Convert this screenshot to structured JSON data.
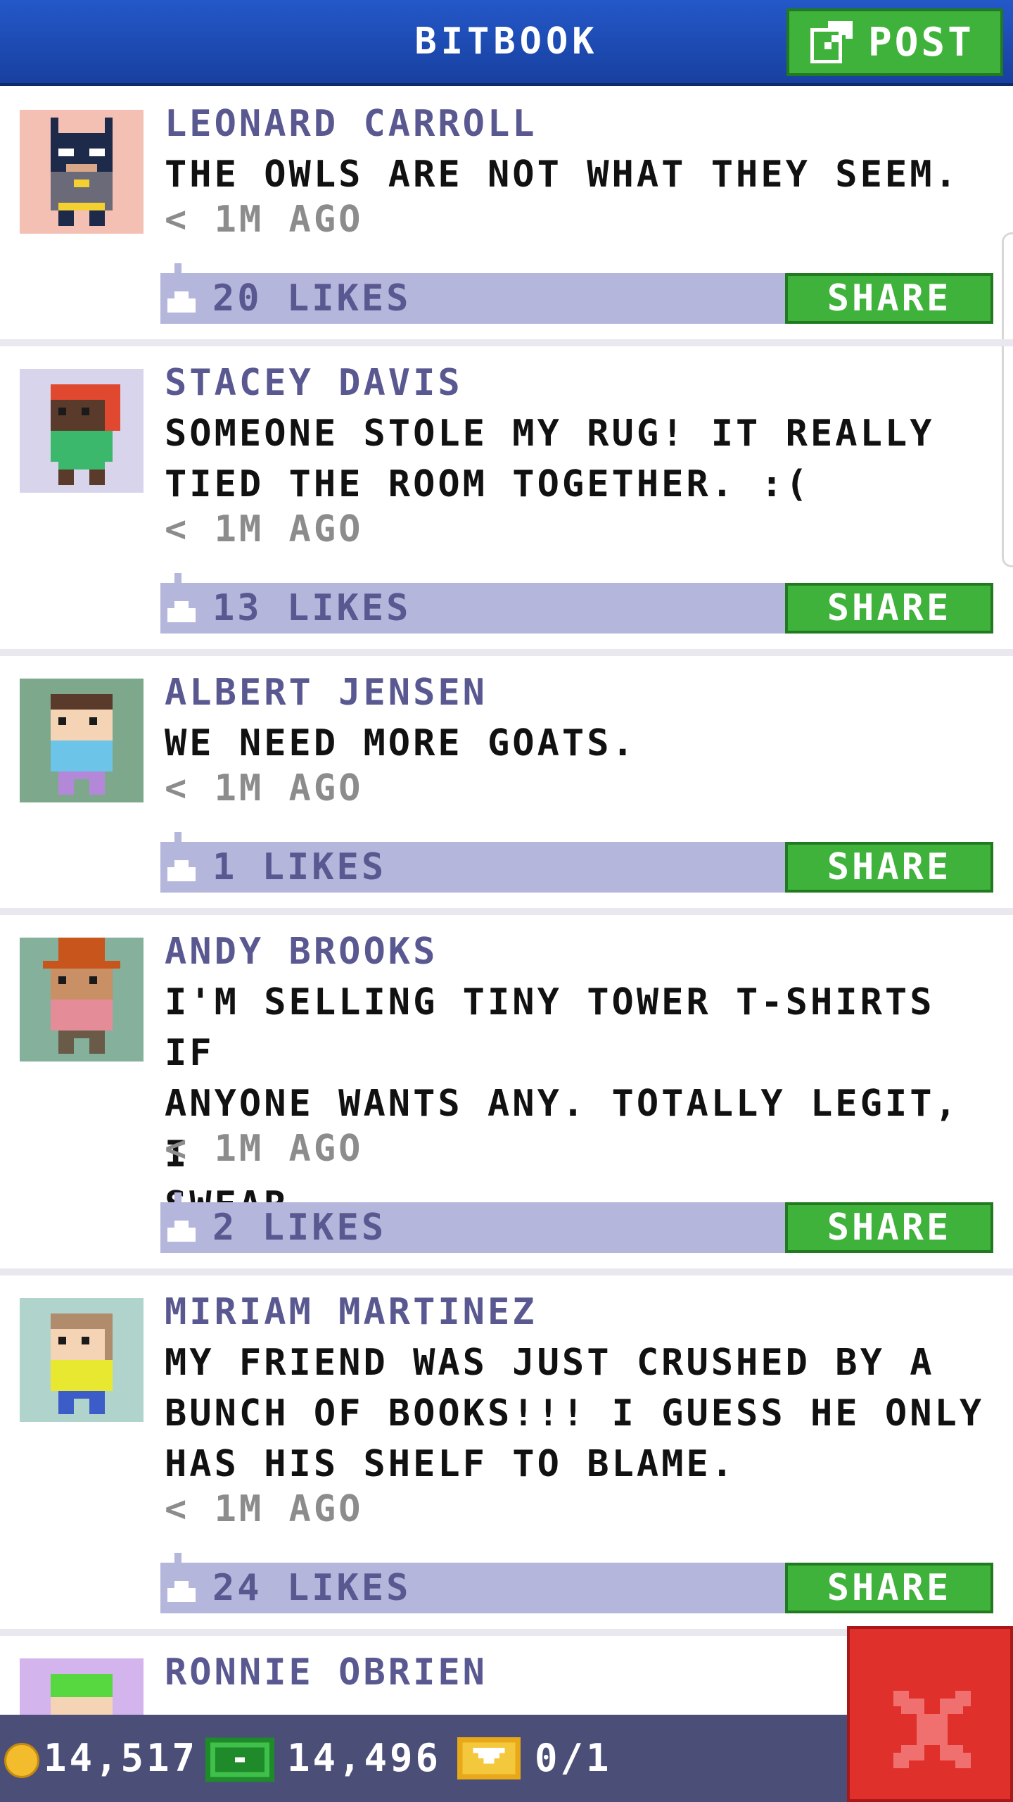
{
  "header": {
    "title": "BITBOOK",
    "post_label": "POST"
  },
  "feed": [
    {
      "author": "LEONARD CARROLL",
      "lines": [
        "THE OWLS ARE NOT WHAT THEY SEEM."
      ],
      "time": "< 1M AGO",
      "likes": "20 LIKES",
      "share": "SHARE",
      "avatar": "batman-costume-bitizen"
    },
    {
      "author": "STACEY DAVIS",
      "lines": [
        "SOMEONE STOLE MY RUG! IT REALLY",
        "TIED THE ROOM TOGETHER. :("
      ],
      "time": "< 1M AGO",
      "likes": "13 LIKES",
      "share": "SHARE",
      "avatar": "red-hair-bitizen"
    },
    {
      "author": "ALBERT JENSEN",
      "lines": [
        "WE NEED MORE GOATS."
      ],
      "time": "< 1M AGO",
      "likes": "1 LIKES",
      "share": "SHARE",
      "avatar": "brown-hair-bitizen"
    },
    {
      "author": "ANDY BROOKS",
      "lines": [
        "I'M SELLING TINY TOWER T-SHIRTS IF",
        "ANYONE WANTS ANY. TOTALLY LEGIT, I",
        "SWEAR."
      ],
      "time": "< 1M AGO",
      "likes": "2 LIKES",
      "share": "SHARE",
      "avatar": "top-hat-bitizen"
    },
    {
      "author": "MIRIAM MARTINEZ",
      "lines": [
        "MY FRIEND WAS JUST CRUSHED BY A",
        "BUNCH OF BOOKS!!! I GUESS HE ONLY",
        "HAS HIS SHELF TO BLAME."
      ],
      "time": "< 1M AGO",
      "likes": "24 LIKES",
      "share": "SHARE",
      "avatar": "blonde-bitizen"
    },
    {
      "author": "RONNIE OBRIEN",
      "lines": [],
      "time": "",
      "likes": "",
      "share": "",
      "avatar": "green-hair-bitizen"
    }
  ],
  "currency": {
    "coins": "14,517",
    "bux": "14,496",
    "tickets": "0/1"
  },
  "icons": [
    "post-icon",
    "like-icon",
    "coin-icon",
    "bux-icon",
    "ticket-icon",
    "close-icon"
  ],
  "colors": {
    "header": "#1e4cb4",
    "accent_green": "#3eb23a",
    "likes_bar": "#b5b6db",
    "author_text": "#5a5890",
    "close_red": "#e0302c",
    "bottom_bar": "#4b4f78"
  }
}
